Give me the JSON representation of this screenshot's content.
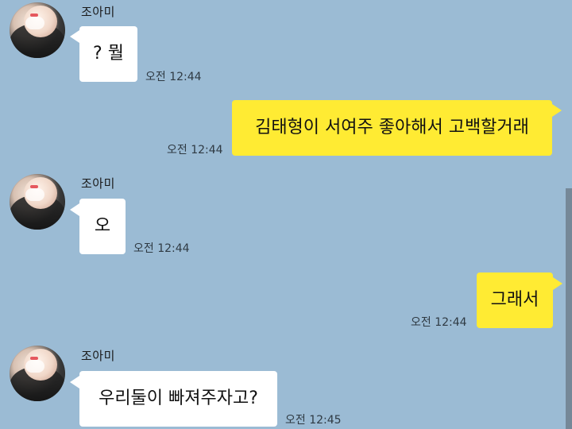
{
  "theme": {
    "background": "#9bbbd4",
    "incoming_bubble": "#ffffff",
    "outgoing_bubble": "#ffeb33"
  },
  "messages": [
    {
      "direction": "incoming",
      "sender": "조아미",
      "text": "? 뭘",
      "time": "오전 12:44",
      "avatar_icon": "profile-photo"
    },
    {
      "direction": "outgoing",
      "text": "김태형이 서여주 좋아해서 고백할거래",
      "time": "오전 12:44"
    },
    {
      "direction": "incoming",
      "sender": "조아미",
      "text": "오",
      "time": "오전 12:44",
      "avatar_icon": "profile-photo"
    },
    {
      "direction": "outgoing",
      "text": "그래서",
      "time": "오전 12:44"
    },
    {
      "direction": "incoming",
      "sender": "조아미",
      "text": "우리둘이 빠져주자고?",
      "time": "오전 12:45",
      "avatar_icon": "profile-photo"
    }
  ]
}
